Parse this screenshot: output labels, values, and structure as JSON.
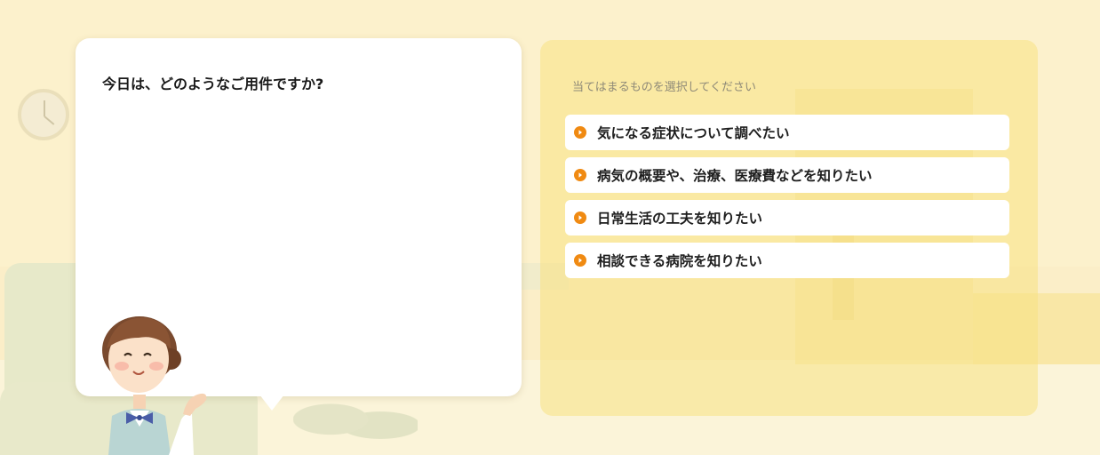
{
  "bubble": {
    "question": "今日は、どのようなご用件ですか?"
  },
  "options": {
    "hint": "当てはまるものを選択してください",
    "items": [
      {
        "label": "気になる症状について調べたい",
        "icon": "orange-chevron-right-circle-icon"
      },
      {
        "label": "病気の概要や、治療、医療費などを知りたい",
        "icon": "orange-chevron-right-circle-icon"
      },
      {
        "label": "日常生活の工夫を知りたい",
        "icon": "orange-chevron-right-circle-icon"
      },
      {
        "label": "相談できる病院を知りたい",
        "icon": "orange-chevron-right-circle-icon"
      }
    ]
  },
  "colors": {
    "background": "#fcf1cc",
    "panel": "#f8e282",
    "accent": "#f08a12",
    "text": "#1e1e1e",
    "hint_text": "#8f8a78"
  }
}
